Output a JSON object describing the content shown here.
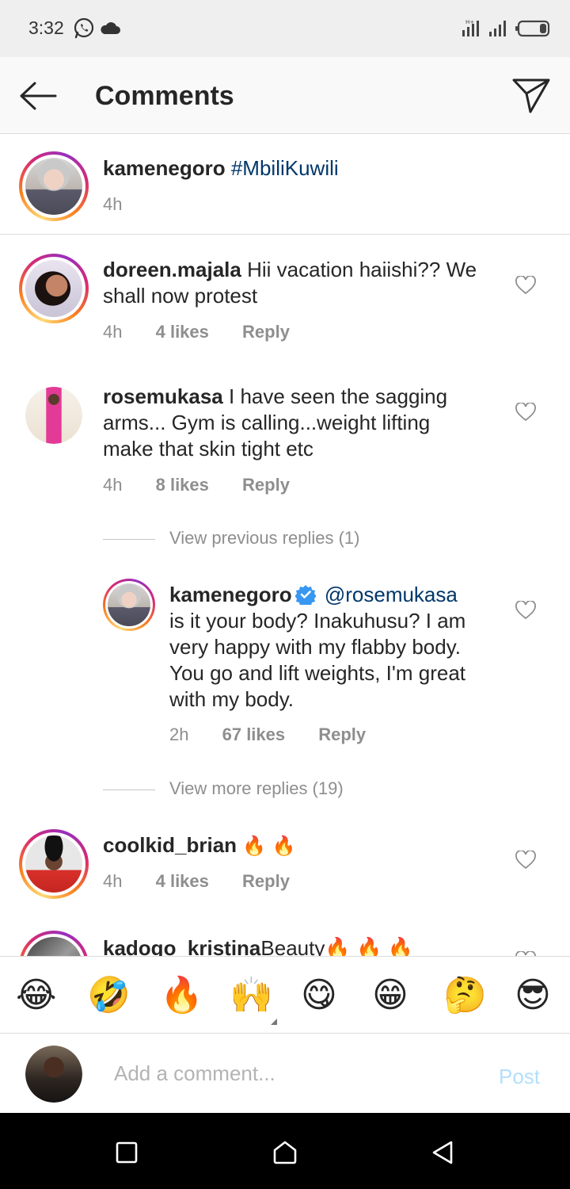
{
  "status_bar": {
    "time": "3:32"
  },
  "header": {
    "title": "Comments"
  },
  "caption": {
    "username": "kamenegoro",
    "text": "#MbiliKuwili",
    "time": "4h"
  },
  "comments": [
    {
      "username": "doreen.majala",
      "lines": [
        "Hii vacation haiishi?? We",
        "shall now protest"
      ],
      "time": "4h",
      "likes": "4 likes",
      "reply": "Reply"
    },
    {
      "username": "rosemukasa",
      "lines": [
        "I have seen the sagging",
        "arms... Gym is calling...weight lifting",
        "make that skin tight etc"
      ],
      "time": "4h",
      "likes": "8 likes",
      "reply": "Reply"
    },
    {
      "username": "coolkid_brian",
      "text": "🔥 🔥",
      "time": "4h",
      "likes": "4 likes",
      "reply": "Reply"
    },
    {
      "username": "kadogo_kristina",
      "text": "Beauty🔥 🔥 🔥"
    }
  ],
  "replies_section": {
    "view_previous": "View previous replies (1)",
    "view_more": "View more replies (19)"
  },
  "reply": {
    "username": "kamenegoro",
    "mention": "@rosemukasa",
    "lines": [
      "is it your body? Inakuhusu? I am",
      "very happy with my flabby body.",
      "You go and lift weights, I'm great",
      "with my body."
    ],
    "time": "2h",
    "likes": "67 likes",
    "reply": "Reply"
  },
  "emoji_bar": [
    "😂",
    "🤣",
    "🔥",
    "🙌",
    "😋",
    "😁",
    "🤔",
    "😎"
  ],
  "composer": {
    "placeholder": "Add a comment...",
    "post_label": "Post"
  },
  "colors": {
    "link": "#00376b",
    "verified": "#3897f0",
    "post_disabled": "#b2dffc",
    "secondary_text": "#8e8e8e"
  },
  "icons": [
    "whatsapp-icon",
    "cloud-icon",
    "signal-icon",
    "battery-icon",
    "back-arrow-icon",
    "direct-message-icon",
    "heart-icon",
    "verified-icon",
    "recent-apps-icon",
    "home-icon",
    "nav-back-icon"
  ]
}
